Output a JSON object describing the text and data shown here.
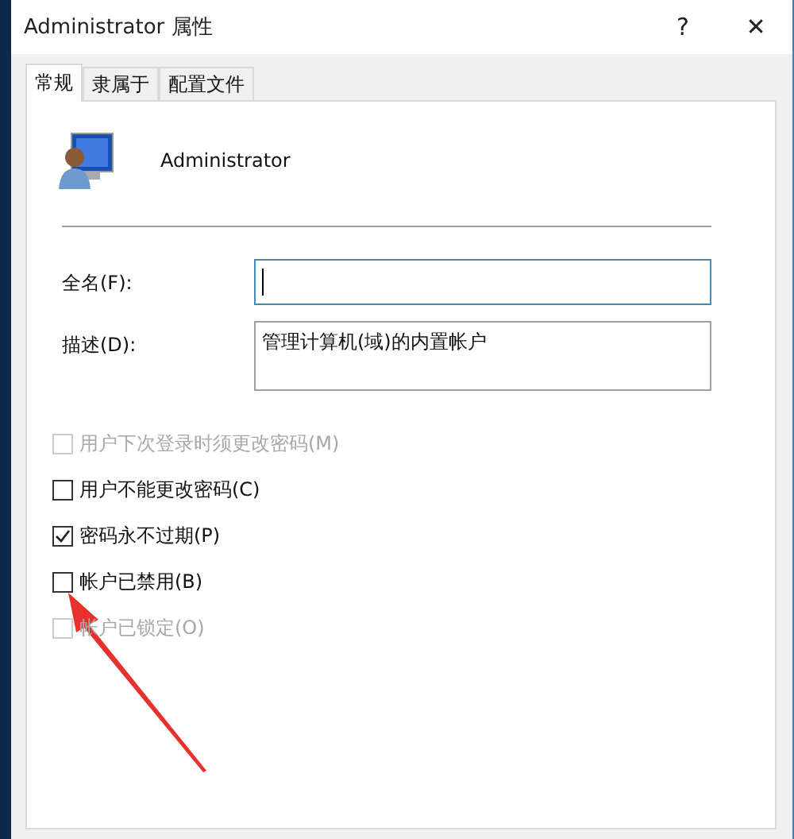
{
  "window": {
    "title": "Administrator 属性",
    "help": "?",
    "close": "✕"
  },
  "tabs": [
    {
      "label": "常规",
      "selected": true
    },
    {
      "label": "隶属于",
      "selected": false
    },
    {
      "label": "配置文件",
      "selected": false
    }
  ],
  "account": {
    "name": "Administrator"
  },
  "fields": [
    {
      "label": "全名(F):",
      "focused": true,
      "multiline": false
    },
    {
      "label": "描述(D):",
      "value": "管理计算机(域)的内置帐户",
      "focused": false,
      "multiline": true
    }
  ],
  "options": [
    {
      "label": "用户下次登录时须更改密码(M)",
      "checked": false,
      "disabled": true
    },
    {
      "label": "用户不能更改密码(C)",
      "checked": false,
      "disabled": false
    },
    {
      "label": "密码永不过期(P)",
      "checked": true,
      "disabled": false
    },
    {
      "label": "帐户已禁用(B)",
      "checked": false,
      "disabled": false
    },
    {
      "label": "帐户已锁定(O)",
      "checked": false,
      "disabled": true
    }
  ]
}
